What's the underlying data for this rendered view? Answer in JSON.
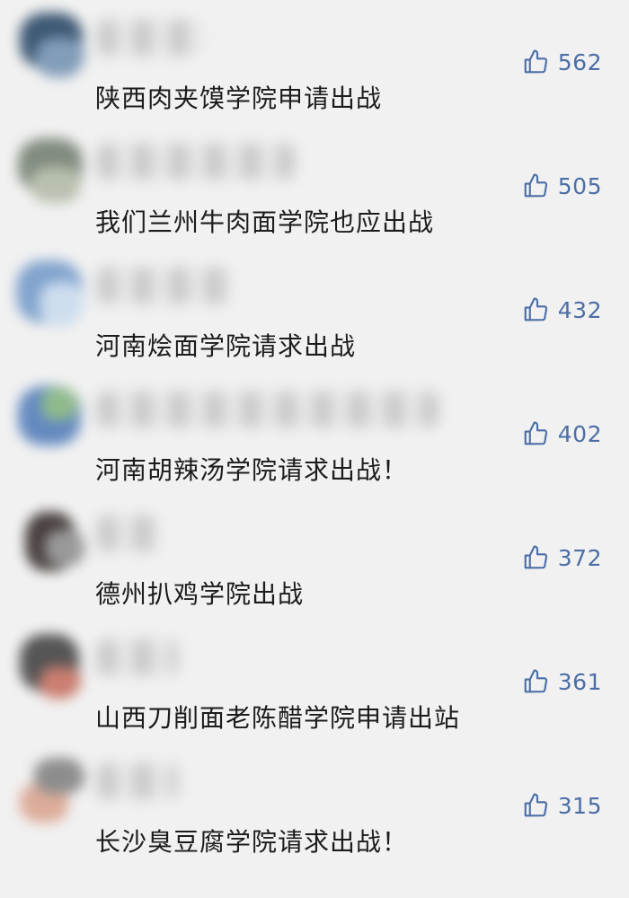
{
  "comments": [
    {
      "text": "陕西肉夹馍学院申请出战",
      "likes": "562",
      "avatar_colors": [
        "#1f3f5f",
        "#6f8fb0"
      ]
    },
    {
      "text": "我们兰州牛肉面学院也应出战",
      "likes": "505",
      "avatar_colors": [
        "#6f7a6c",
        "#b0b8a4"
      ]
    },
    {
      "text": "河南烩面学院请求出战",
      "likes": "432",
      "avatar_colors": [
        "#6f96c8",
        "#c8dbee"
      ]
    },
    {
      "text": "河南胡辣汤学院请求出战！",
      "likes": "402",
      "avatar_colors": [
        "#4c78b8",
        "#7fb27a"
      ]
    },
    {
      "text": "德州扒鸡学院出战",
      "likes": "372",
      "avatar_colors": [
        "#2a2020",
        "#8a8a8a"
      ]
    },
    {
      "text": "山西刀削面老陈醋学院申请出站",
      "likes": "361",
      "avatar_colors": [
        "#3a3a3a",
        "#c46a5a"
      ]
    },
    {
      "text": "长沙臭豆腐学院请求出战！",
      "likes": "315",
      "avatar_colors": [
        "#d9a08a",
        "#7c7c7c"
      ]
    }
  ],
  "colors": {
    "background": "#f1f1f1",
    "like_accent": "#4c6ea6",
    "text": "#1c1c1c"
  },
  "icons": {
    "like": "thumbs-up-icon"
  }
}
